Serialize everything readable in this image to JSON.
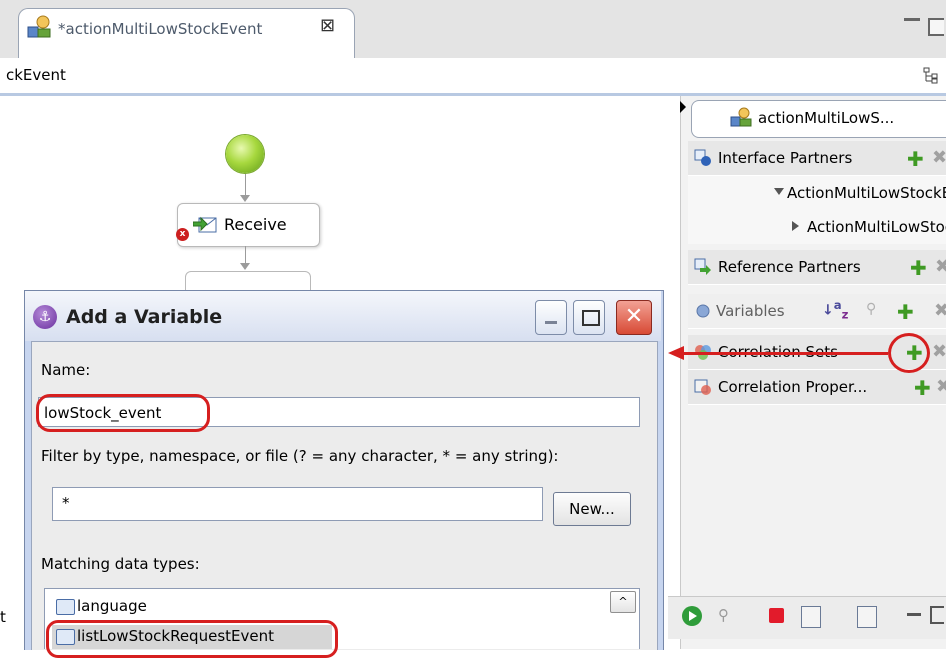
{
  "editor": {
    "tab_label": "*actionMultiLowStockEvent",
    "breadcrumb": "ckEvent"
  },
  "canvas": {
    "receive_label": "Receive"
  },
  "right_panel": {
    "process_title": "actionMultiLowS...",
    "rows": {
      "interface_partners": "Interface Partners",
      "interface_child": "ActionMultiLowStockEve",
      "interface_grandchild": "ActionMultiLowStock",
      "reference_partners": "Reference Partners",
      "variables": "Variables",
      "correlation_sets": "Correlation Sets",
      "correlation_properties": "Correlation Proper..."
    },
    "sort_glyph": "a z"
  },
  "dialog": {
    "title": "Add a Variable",
    "name_label": "Name:",
    "name_value": "lowStock_event",
    "filter_label": "Filter by type, namespace, or file (? = any character, * = any string):",
    "filter_value": "*",
    "new_button": "New...",
    "matching_label": "Matching data types:",
    "data_types": [
      "language",
      "listLowStockRequestEvent"
    ],
    "scroll_up": "^"
  },
  "left_edge_text": "t",
  "colors": {
    "annotation": "#d61f1f",
    "plus_icon": "#3f9a23",
    "stop_icon": "#e21b2b"
  },
  "icons": [
    "process-icon",
    "close-tab-icon",
    "outline-icon",
    "start-node-icon",
    "receive-icon",
    "error-icon",
    "interface-icon",
    "reference-icon",
    "variables-icon",
    "sort-icon",
    "add-icon",
    "delete-icon",
    "correlation-sets-icon",
    "correlation-properties-icon",
    "run-icon",
    "stop-icon",
    "add-variable-icon",
    "minimize-icon",
    "maximize-icon",
    "close-icon",
    "scroll-up-icon"
  ]
}
